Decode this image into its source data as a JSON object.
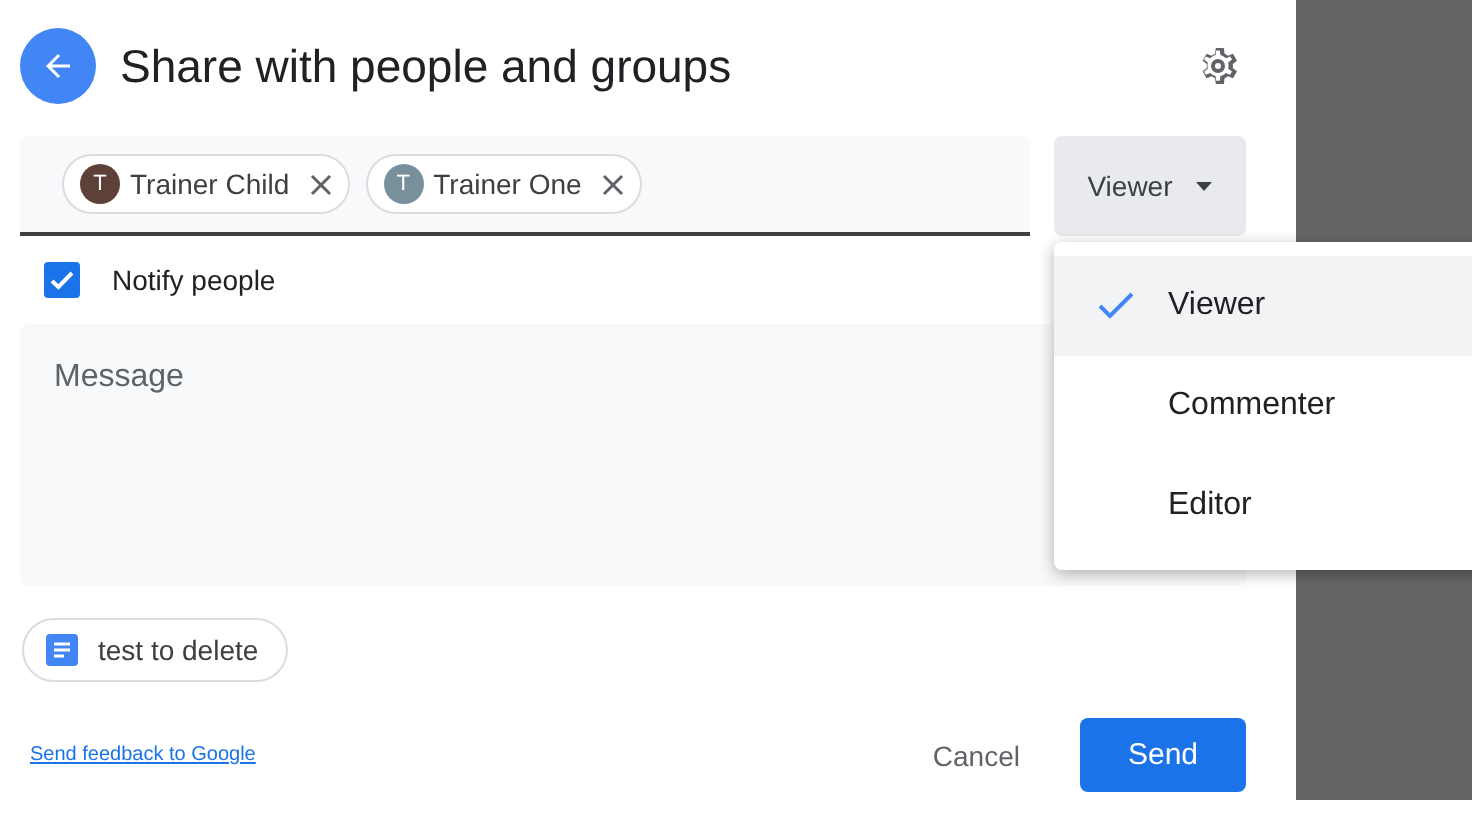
{
  "dialog": {
    "title": "Share with people and groups"
  },
  "recipients": [
    {
      "name": "Trainer Child",
      "initial": "T",
      "color": "#5d4037"
    },
    {
      "name": "Trainer One",
      "initial": "T",
      "color": "#78909c"
    }
  ],
  "role_button": {
    "label": "Viewer"
  },
  "role_menu": [
    {
      "label": "Viewer",
      "selected": true
    },
    {
      "label": "Commenter",
      "selected": false
    },
    {
      "label": "Editor",
      "selected": false
    }
  ],
  "notify": {
    "label": "Notify people",
    "checked": true
  },
  "message": {
    "placeholder": "Message"
  },
  "file": {
    "name": "test to delete"
  },
  "feedback_link": "Send feedback to Google",
  "buttons": {
    "cancel": "Cancel",
    "send": "Send"
  }
}
